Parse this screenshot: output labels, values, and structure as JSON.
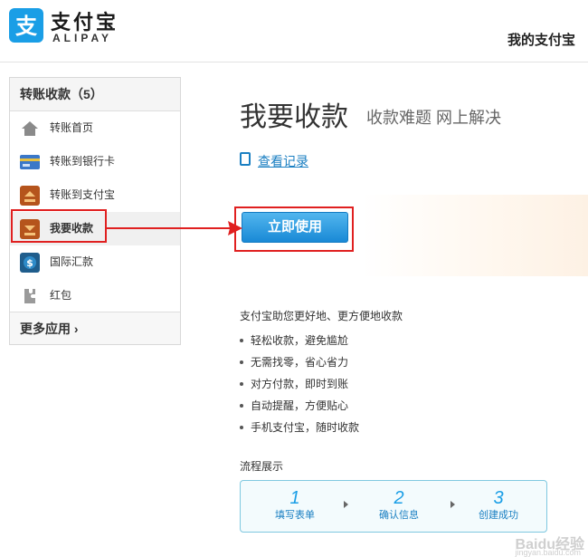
{
  "header": {
    "logo_text": "支付宝",
    "logo_en": "ALIPAY",
    "my_alipay_link": "我的支付宝"
  },
  "sidebar": {
    "title": "转账收款（5）",
    "items": [
      {
        "label": "转账首页",
        "icon": "home-icon"
      },
      {
        "label": "转账到银行卡",
        "icon": "bank-card-icon"
      },
      {
        "label": "转账到支付宝",
        "icon": "transfer-to-alipay-icon"
      },
      {
        "label": "我要收款",
        "icon": "receive-money-icon",
        "active": true
      },
      {
        "label": "国际汇款",
        "icon": "international-remittance-icon"
      },
      {
        "label": "红包",
        "icon": "red-packet-icon"
      }
    ],
    "more": "更多应用"
  },
  "main": {
    "title": "我要收款",
    "subtitle": "收款难题 网上解决",
    "records_link": "查看记录",
    "use_button": "立即使用",
    "intro": "支付宝助您更好地、更方便地收款",
    "benefits": [
      "轻松收款，避免尴尬",
      "无需找零，省心省力",
      "对方付款，即时到账",
      "自动提醒，方便贴心",
      "手机支付宝，随时收款"
    ],
    "process_title": "流程展示",
    "steps": [
      {
        "num": "1",
        "label": "填写表单"
      },
      {
        "num": "2",
        "label": "确认信息"
      },
      {
        "num": "3",
        "label": "创建成功"
      }
    ]
  },
  "colors": {
    "brand_blue": "#1a9ee6",
    "highlight_red": "#e02020",
    "link_blue": "#1a7fc2"
  },
  "watermark": {
    "text": "Baidu经验",
    "sub": "jingyan.baidu.com"
  }
}
